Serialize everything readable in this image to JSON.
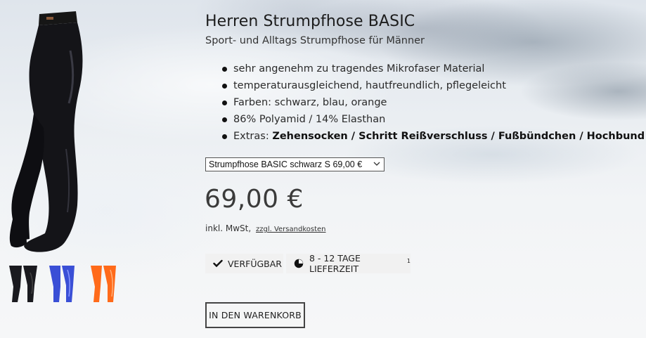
{
  "product": {
    "title": "Herren Strumpfhose BASIC",
    "subtitle": "Sport- und Alltags Strumpfhose für Männer",
    "features": [
      {
        "text": "sehr angenehm zu tragendes Mikrofaser Material"
      },
      {
        "text": "temperaturausgleichend, hautfreundlich, pflegeleicht"
      },
      {
        "text": "Farben: schwarz, blau, orange"
      },
      {
        "text": "86% Polyamid / 14% Elasthan"
      },
      {
        "prefix": "Extras: ",
        "bold": "Zehensocken / Schritt Reißverschluss / Fußbündchen / Hochbund"
      }
    ],
    "variant_selected": "Strumpfhose BASIC schwarz S 69,00 €",
    "price": "69,00 €",
    "tax_text": "inkl. MwSt,",
    "shipping_link": "zzgl. Versandkosten",
    "availability": "VERFÜGBAR",
    "delivery_time": "8 - 12 TAGE LIEFERZEIT",
    "delivery_footnote": "1",
    "cart_button": "IN DEN WARENKORB"
  },
  "thumbnails": [
    {
      "color_name": "schwarz",
      "color": "#1a1a1f"
    },
    {
      "color_name": "blau",
      "color": "#3a4fd6"
    },
    {
      "color_name": "orange",
      "color": "#ff6a1a"
    }
  ],
  "icons": {
    "availability": "checkmark-icon",
    "delivery": "clock-pie-icon",
    "select": "chevron-down-icon"
  }
}
